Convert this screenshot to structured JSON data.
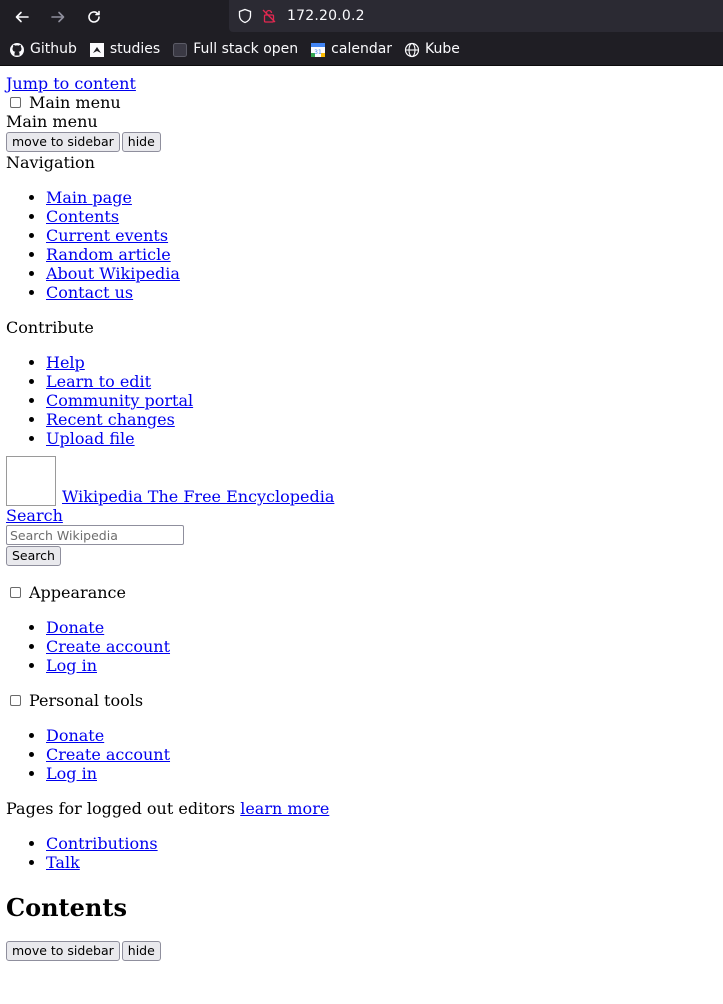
{
  "browser": {
    "url": "172.20.0.2",
    "bookmarks": [
      {
        "label": "Github",
        "icon": "github-icon"
      },
      {
        "label": "studies",
        "icon": "studies-icon"
      },
      {
        "label": "Full stack open",
        "icon": "fullstack-icon"
      },
      {
        "label": "calendar",
        "icon": "calendar-icon"
      },
      {
        "label": "Kube",
        "icon": "globe-icon"
      }
    ]
  },
  "page": {
    "jump_link": "Jump to content",
    "main_menu_toggle": "Main menu",
    "main_menu_heading": "Main menu",
    "move_to_sidebar": "move to sidebar",
    "hide": "hide",
    "navigation_heading": "Navigation",
    "navigation": [
      "Main page",
      "Contents",
      "Current events",
      "Random article",
      "About Wikipedia",
      "Contact us"
    ],
    "contribute_heading": "Contribute",
    "contribute": [
      "Help",
      "Learn to edit",
      "Community portal",
      "Recent changes",
      "Upload file"
    ],
    "logo_text": "Wikipedia The Free Encyclopedia",
    "search_link": "Search",
    "search_placeholder": "Search Wikipedia",
    "search_button": "Search",
    "appearance_toggle": "Appearance",
    "appearance_links": [
      "Donate",
      "Create account",
      "Log in"
    ],
    "personal_tools_toggle": "Personal tools",
    "personal_links": [
      "Donate",
      "Create account",
      "Log in"
    ],
    "logged_out_text": "Pages for logged out editors",
    "learn_more": "learn more",
    "logged_out_links": [
      "Contributions",
      "Talk"
    ],
    "contents_heading": "Contents",
    "contents_move_to_sidebar": "move to sidebar",
    "contents_hide": "hide"
  }
}
